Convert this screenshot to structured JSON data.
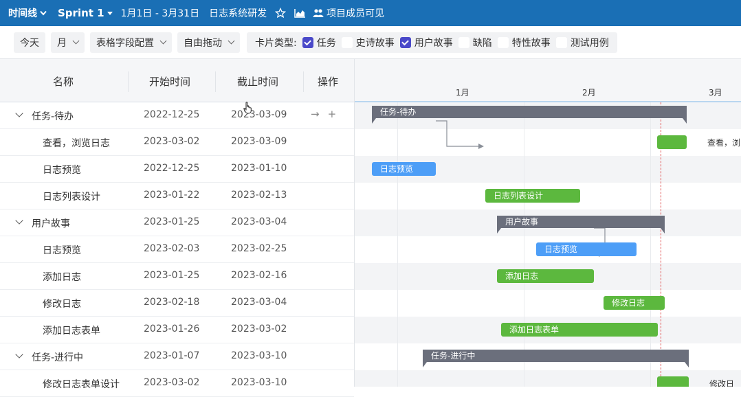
{
  "topbar": {
    "view_label": "时间线",
    "sprint_label": "Sprint 1",
    "date_range": "1月1日 - 3月31日",
    "project_name": "日志系统研发",
    "members_label": "项目成员可见"
  },
  "toolbar": {
    "today_label": "今天",
    "scale_label": "月",
    "fields_label": "表格字段配置",
    "drag_label": "自由拖动",
    "card_types_label": "卡片类型:",
    "card_types": [
      {
        "label": "任务",
        "checked": true
      },
      {
        "label": "史诗故事",
        "checked": false
      },
      {
        "label": "用户故事",
        "checked": true
      },
      {
        "label": "缺陷",
        "checked": false
      },
      {
        "label": "特性故事",
        "checked": false
      },
      {
        "label": "测试用例",
        "checked": false
      }
    ]
  },
  "table": {
    "headers": {
      "name": "名称",
      "start": "开始时间",
      "end": "截止时间",
      "ops": "操作"
    },
    "rows": [
      {
        "name": "任务-待办",
        "start": "2022-12-25",
        "end": "2023-03-09",
        "group": true,
        "actions": true
      },
      {
        "name": "查看，浏览日志",
        "start": "2023-03-02",
        "end": "2023-03-09",
        "group": false
      },
      {
        "name": "日志预览",
        "start": "2022-12-25",
        "end": "2023-01-10",
        "group": false
      },
      {
        "name": "日志列表设计",
        "start": "2023-01-22",
        "end": "2023-02-13",
        "group": false
      },
      {
        "name": "用户故事",
        "start": "2023-01-25",
        "end": "2023-03-04",
        "group": true
      },
      {
        "name": "日志预览",
        "start": "2023-02-03",
        "end": "2023-02-25",
        "group": false
      },
      {
        "name": "添加日志",
        "start": "2023-01-25",
        "end": "2023-02-16",
        "group": false
      },
      {
        "name": "修改日志",
        "start": "2023-02-18",
        "end": "2023-03-04",
        "group": false
      },
      {
        "name": "添加日志表单",
        "start": "2023-01-26",
        "end": "2023-03-02",
        "group": false
      },
      {
        "name": "任务-进行中",
        "start": "2023-01-07",
        "end": "2023-03-10",
        "group": true
      },
      {
        "name": "修改日志表单设计",
        "start": "2023-03-02",
        "end": "2023-03-10",
        "group": false
      }
    ]
  },
  "gantt": {
    "months": [
      "1月",
      "2月",
      "3月"
    ],
    "bars": [
      {
        "row": 0,
        "label": "任务-待办",
        "kind": "group"
      },
      {
        "row": 1,
        "label": "",
        "kind": "green",
        "outside_label": "查看，浏"
      },
      {
        "row": 2,
        "label": "日志预览",
        "kind": "blue"
      },
      {
        "row": 3,
        "label": "日志列表设计",
        "kind": "green"
      },
      {
        "row": 4,
        "label": "用户故事",
        "kind": "group"
      },
      {
        "row": 5,
        "label": "日志预览",
        "kind": "blue"
      },
      {
        "row": 6,
        "label": "添加日志",
        "kind": "green"
      },
      {
        "row": 7,
        "label": "修改日志",
        "kind": "green"
      },
      {
        "row": 8,
        "label": "添加日志表单",
        "kind": "green"
      },
      {
        "row": 9,
        "label": "任务-进行中",
        "kind": "group"
      },
      {
        "row": 10,
        "label": "",
        "kind": "green",
        "outside_label": "修改日"
      }
    ],
    "colors": {
      "blue": "#4d9ef7",
      "green": "#5cb83e",
      "group": "#6b6f7c",
      "today": "#e15454"
    }
  }
}
